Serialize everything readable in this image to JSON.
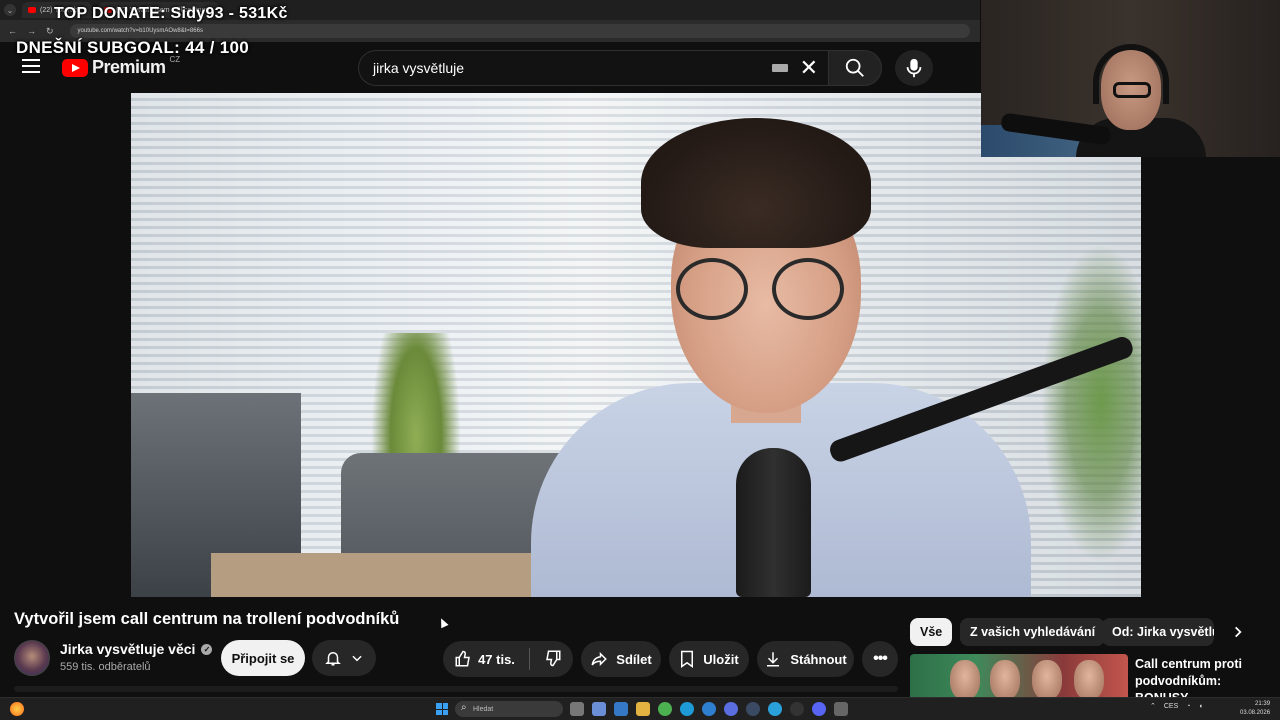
{
  "browser": {
    "tabs": [
      {
        "label": "(22) YouTube"
      },
      {
        "label": "(22) Vytvořil jsem call centrum"
      }
    ],
    "url": "youtube.com/watch?v=b10UysmAOw8&t=866s"
  },
  "stream_overlay": {
    "top_donate": "TOP DONATE: Sidy93 - 531Kč",
    "subgoal": "DNEŠNÍ SUBGOAL: 44 / 100"
  },
  "youtube": {
    "logo_text": "Premium",
    "country_code": "CZ",
    "search_value": "jirka vysvětluje"
  },
  "video": {
    "title": "Vytvořil jsem call centrum na trollení podvodníků",
    "channel": "Jirka vysvětluje věci",
    "subscribers": "559 tis. odběratelů",
    "subscribe_label": "Připojit se",
    "likes": "47 tis.",
    "share_label": "Sdílet",
    "save_label": "Uložit",
    "download_label": "Stáhnout"
  },
  "sidebar": {
    "chips": [
      "Vše",
      "Z vašich vyhledávání",
      "Od: Jirka vysvětluje věci"
    ],
    "recommendation_title": "Call centrum proti podvodníkům: BONUSY"
  },
  "taskbar": {
    "search_placeholder": "Hledat",
    "language": "CES",
    "time": "21:39",
    "date": "03.08.2026"
  },
  "colors": {
    "background": "#0f0f0f",
    "youtube_red": "#ff0000",
    "chip_active": "#f1f1f1",
    "pill": "#272727"
  }
}
